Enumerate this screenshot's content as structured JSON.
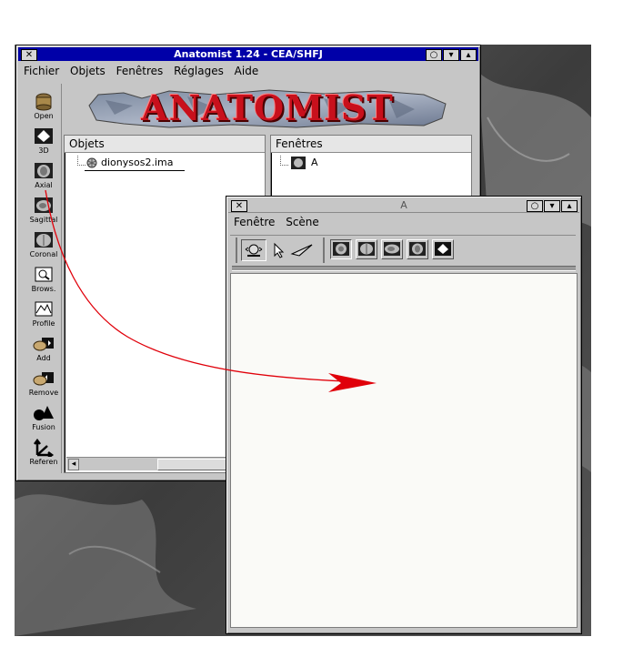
{
  "main_window": {
    "title": "Anatomist 1.24 - CEA/SHFJ",
    "menu": [
      "Fichier",
      "Objets",
      "Fenêtres",
      "Réglages",
      "Aide"
    ],
    "banner_text": "ANATOMIST",
    "toolbar": [
      {
        "label": "Open",
        "icon": "open-icon"
      },
      {
        "label": "3D",
        "icon": "3d-view-icon"
      },
      {
        "label": "Axial",
        "icon": "axial-view-icon"
      },
      {
        "label": "Sagittal",
        "icon": "sagittal-view-icon"
      },
      {
        "label": "Coronal",
        "icon": "coronal-view-icon"
      },
      {
        "label": "Brows.",
        "icon": "browser-icon"
      },
      {
        "label": "Profile",
        "icon": "profile-icon"
      },
      {
        "label": "Add",
        "icon": "add-icon"
      },
      {
        "label": "Remove",
        "icon": "remove-icon"
      },
      {
        "label": "Fusion",
        "icon": "fusion-icon"
      },
      {
        "label": "Referen",
        "icon": "referential-icon"
      }
    ],
    "objects_panel": {
      "header": "Objets",
      "items": [
        "dionysos2.ima"
      ]
    },
    "windows_panel": {
      "header": "Fenêtres",
      "items": [
        "A"
      ]
    }
  },
  "child_window": {
    "title": "A",
    "menu": [
      "Fenêtre",
      "Scène"
    ],
    "tools": [
      "trackball-control-icon",
      "select-pointer-icon",
      "flight-control-icon"
    ],
    "view_buttons": [
      "axial-view-icon",
      "coronal-view-icon",
      "sagittal-view-icon",
      "oblique-view-icon",
      "3d-view-icon"
    ]
  },
  "colors": {
    "title_active": "#0000a8",
    "window_face": "#c6c6c6",
    "banner_red": "#c8101c",
    "annotation_arrow": "#e0000a"
  }
}
